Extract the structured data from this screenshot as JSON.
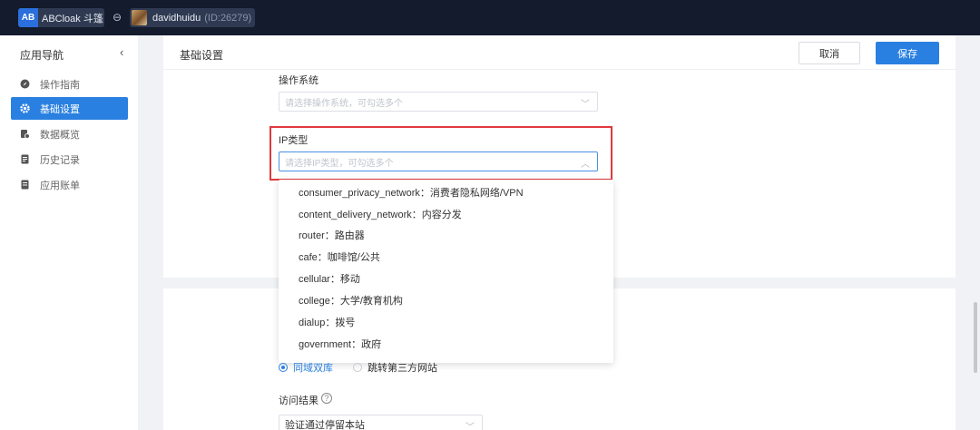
{
  "topbar": {
    "app_logo": "AB",
    "app_name": "ABCloak 斗篷",
    "user_name": "davidhuidu",
    "user_id": "(ID:26279)"
  },
  "sidebar": {
    "header": "应用导航",
    "items": [
      {
        "label": "操作指南",
        "icon": "compass-icon"
      },
      {
        "label": "基础设置",
        "icon": "gear-icon",
        "active": true
      },
      {
        "label": "数据概览",
        "icon": "data-icon"
      },
      {
        "label": "历史记录",
        "icon": "document-icon"
      },
      {
        "label": "应用账单",
        "icon": "bill-icon"
      }
    ]
  },
  "header": {
    "title": "基础设置",
    "cancel_label": "取消",
    "save_label": "保存"
  },
  "form": {
    "os_label": "操作系统",
    "os_placeholder": "请选择操作系统，可勾选多个",
    "ip_label": "IP类型",
    "ip_placeholder": "请选择IP类型，可勾选多个",
    "ip_options": [
      "consumer_privacy_network：消费者隐私网络/VPN",
      "content_delivery_network：内容分发",
      "router：路由器",
      "cafe：咖啡馆/公共",
      "cellular：移动",
      "college：大学/教育机构",
      "dialup：拨号",
      "government：政府"
    ],
    "radio_options": [
      {
        "label": "同域双库",
        "checked": true
      },
      {
        "label": "跳转第三方网站",
        "checked": false
      }
    ],
    "access_result_label": "访问结果",
    "access_result_value": "验证通过停留本站"
  },
  "colors": {
    "accent": "#2a80e0",
    "topbar": "#131b2c",
    "highlight": "#e0393e"
  }
}
